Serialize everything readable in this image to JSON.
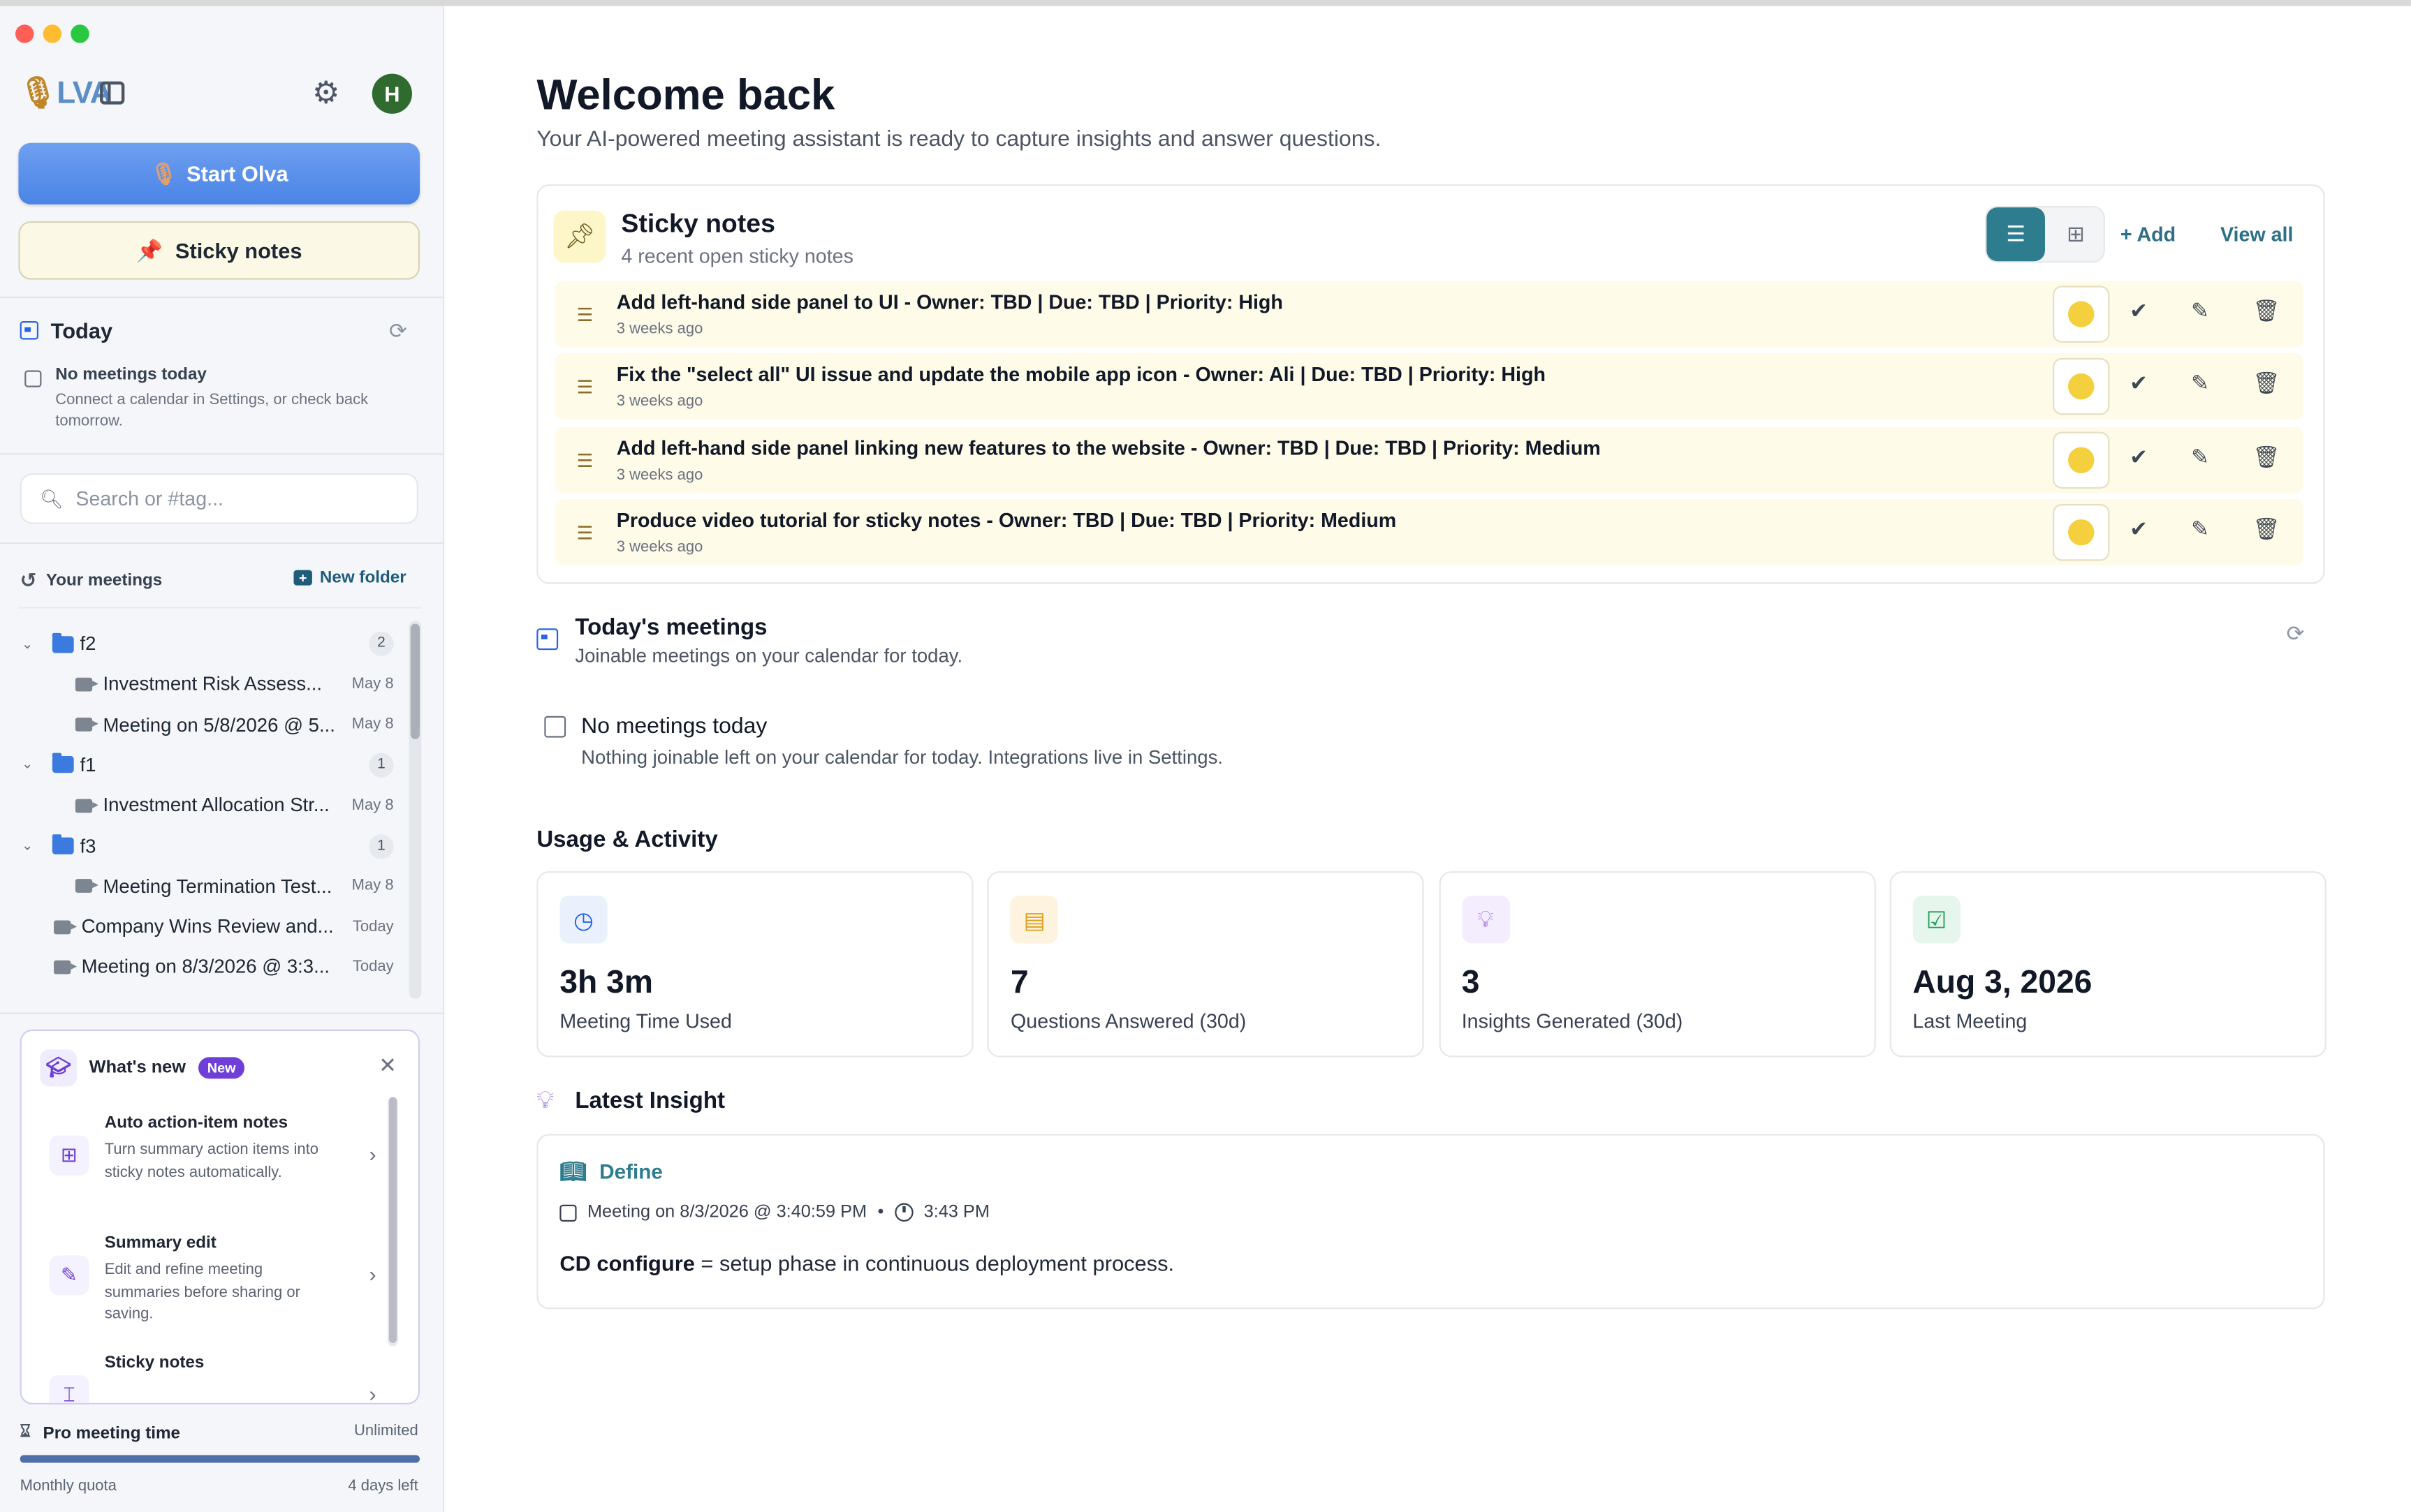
{
  "window": {
    "traffic_lights": {
      "close": "#ff5f57",
      "minimize": "#febc2e",
      "zoom": "#28c840"
    }
  },
  "sidebar": {
    "logo": {
      "mic": "🎙",
      "text": "LVA"
    },
    "avatar_initial": "H",
    "start_button_label": "Start Olva",
    "sticky_button_label": "Sticky notes",
    "today": {
      "title": "Today",
      "empty_title": "No meetings today",
      "empty_desc": "Connect a calendar in Settings, or check back tomorrow."
    },
    "search_placeholder": "Search or #tag...",
    "your_meetings_label": "Your meetings",
    "new_folder_label": "New folder",
    "tree": [
      {
        "type": "folder",
        "name": "f2",
        "count": "2"
      },
      {
        "type": "meeting",
        "name": "Investment Risk Assess...",
        "date": "May 8",
        "indent": true
      },
      {
        "type": "meeting",
        "name": "Meeting on 5/8/2026 @ 5...",
        "date": "May 8",
        "indent": true
      },
      {
        "type": "folder",
        "name": "f1",
        "count": "1"
      },
      {
        "type": "meeting",
        "name": "Investment Allocation Str...",
        "date": "May 8",
        "indent": true
      },
      {
        "type": "folder",
        "name": "f3",
        "count": "1"
      },
      {
        "type": "meeting",
        "name": "Meeting Termination Test...",
        "date": "May 8",
        "indent": true
      },
      {
        "type": "meeting",
        "name": "Company Wins Review and...",
        "date": "Today",
        "indent": false
      },
      {
        "type": "meeting",
        "name": "Meeting on 8/3/2026 @ 3:3...",
        "date": "Today",
        "indent": false
      }
    ],
    "whats_new": {
      "title": "What's new",
      "badge": "New",
      "items": [
        {
          "title": "Auto action-item notes",
          "desc": "Turn summary action items into sticky notes automatically."
        },
        {
          "title": "Summary edit",
          "desc": "Edit and refine meeting summaries before sharing or saving."
        },
        {
          "title": "Sticky notes",
          "desc": ""
        }
      ]
    },
    "quota": {
      "label": "Pro meeting time",
      "value": "Unlimited",
      "footer_left": "Monthly quota",
      "footer_right": "4 days left",
      "fill_fraction": 1.0
    }
  },
  "main": {
    "welcome_title": "Welcome back",
    "welcome_sub": "Your AI-powered meeting assistant is ready to capture insights and answer questions.",
    "sticky": {
      "title": "Sticky notes",
      "subtitle": "4 recent open sticky notes",
      "add_label": "+ Add",
      "view_all_label": "View all",
      "notes": [
        {
          "text": "Add left-hand side panel to UI - Owner: TBD | Due: TBD | Priority: High",
          "age": "3 weeks ago"
        },
        {
          "text": "Fix the \"select all\" UI issue and update the mobile app icon - Owner: Ali | Due: TBD | Priority: High",
          "age": "3 weeks ago"
        },
        {
          "text": "Add left-hand side panel linking new features to the website - Owner: TBD | Due: TBD | Priority: Medium",
          "age": "3 weeks ago"
        },
        {
          "text": "Produce video tutorial for sticky notes - Owner: TBD | Due: TBD | Priority: Medium",
          "age": "3 weeks ago"
        }
      ]
    },
    "todays_meetings": {
      "title": "Today's meetings",
      "subtitle": "Joinable meetings on your calendar for today.",
      "empty_title": "No meetings today",
      "empty_desc": "Nothing joinable left on your calendar for today. Integrations live in Settings."
    },
    "usage": {
      "title": "Usage & Activity",
      "stats": [
        {
          "value": "3h 3m",
          "label": "Meeting Time Used",
          "icon": "clock-icon",
          "color": "#2563eb",
          "bg": "#eaf1fd"
        },
        {
          "value": "7",
          "label": "Questions Answered (30d)",
          "icon": "chat-icon",
          "color": "#e0a11b",
          "bg": "#fdf3de"
        },
        {
          "value": "3",
          "label": "Insights Generated (30d)",
          "icon": "lightbulb-icon",
          "color": "#8a4fe0",
          "bg": "#f3edfd"
        },
        {
          "value": "Aug 3, 2026",
          "label": "Last Meeting",
          "icon": "calendar-check-icon",
          "color": "#1f9d55",
          "bg": "#e6f6ec"
        }
      ]
    },
    "latest_insight": {
      "title": "Latest Insight",
      "type": "Define",
      "meeting": "Meeting on 8/3/2026 @ 3:40:59 PM",
      "separator": "•",
      "time": "3:43 PM",
      "term": "CD configure",
      "definition": " = setup phase in continuous deployment process."
    }
  }
}
